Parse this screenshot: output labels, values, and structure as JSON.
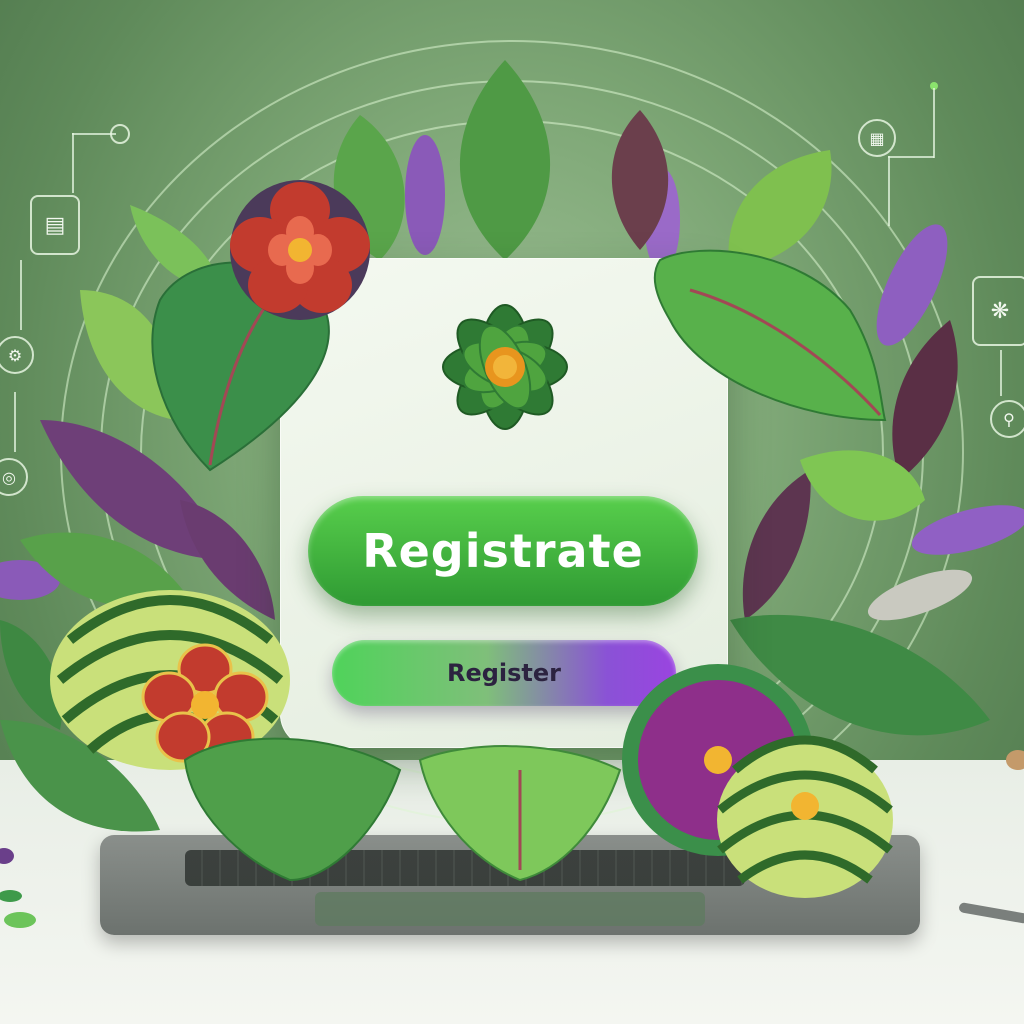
{
  "buttons": {
    "primary_label": "Registrate",
    "secondary_label": "Register"
  },
  "colors": {
    "primary_button": "#3fb63d",
    "secondary_button_start": "#4fd35a",
    "secondary_button_end": "#9a44e0",
    "background": "#7fa877"
  },
  "icons": [
    "document-icon",
    "gear-icon",
    "globe-icon",
    "fingerprint-icon",
    "search-icon",
    "location-icon"
  ]
}
